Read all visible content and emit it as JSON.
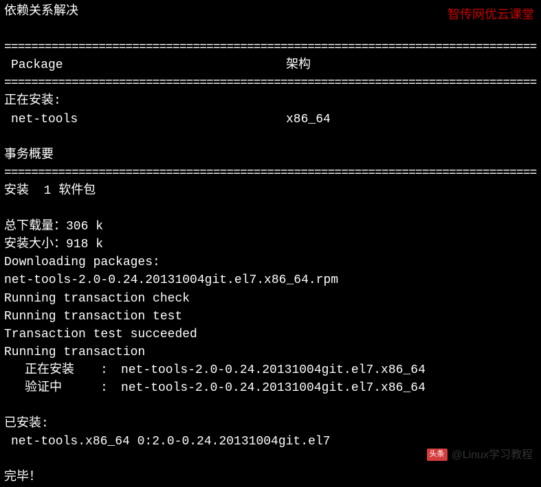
{
  "watermark": "智传网优云课堂",
  "header": {
    "deps_resolved": "依赖关系解决",
    "col_package": "Package",
    "col_arch": "架构"
  },
  "hr": "================================================================================",
  "install_section": {
    "installing": "正在安装:",
    "package_name": "net-tools",
    "arch": "x86_64"
  },
  "summary": {
    "title": "事务概要",
    "install_count": "安装  1 软件包",
    "total_download": "总下载量：306 k",
    "install_size": "安装大小：918 k"
  },
  "progress": {
    "downloading": "Downloading packages:",
    "rpm_file": "net-tools-2.0-0.24.20131004git.el7.x86_64.rpm",
    "run_check": "Running transaction check",
    "run_test": "Running transaction test",
    "test_succeeded": "Transaction test succeeded",
    "run_trans": "Running transaction",
    "installing_label": "正在安装",
    "verifying_label": "验证中",
    "sep": ":",
    "pkg_full": "net-tools-2.0-0.24.20131004git.el7.x86_64"
  },
  "installed": {
    "title": "已安装:",
    "pkg": "net-tools.x86_64 0:2.0-0.24.20131004git.el7"
  },
  "done": "完毕！",
  "footer": {
    "badge": "头条",
    "text": "@Linux学习教程"
  }
}
